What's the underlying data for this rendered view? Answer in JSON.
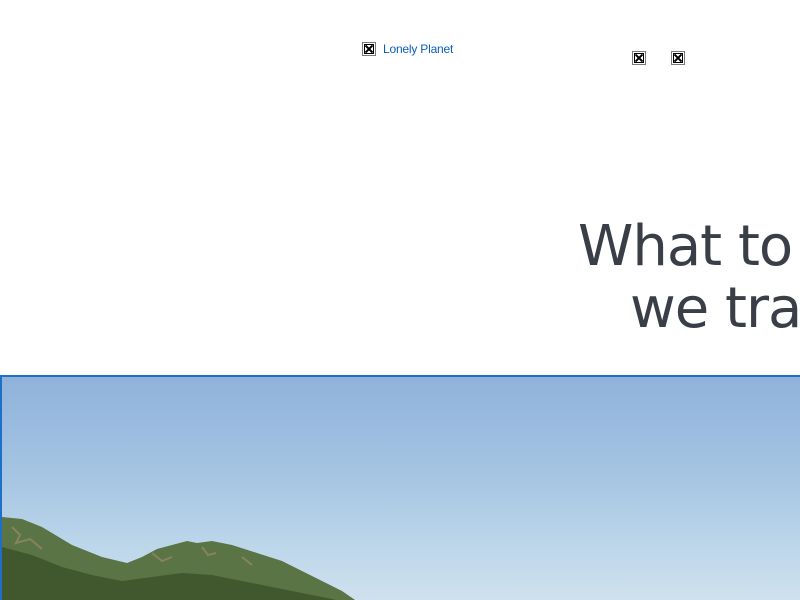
{
  "header": {
    "logo_text": "Lonely Planet"
  },
  "article": {
    "headline_line1": "What to",
    "headline_line2": "we trav"
  },
  "hero": {
    "sky_color": "#a6c5e3",
    "mountain_color": "#4f6a3c",
    "border_color": "#1f6fc6"
  },
  "icons": {
    "logo": "broken-image-icon",
    "nav_icon_1": "broken-image-icon",
    "nav_icon_2": "broken-image-icon"
  }
}
